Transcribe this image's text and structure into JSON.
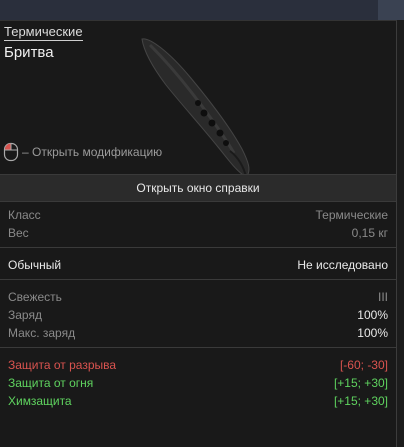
{
  "header": {
    "category": "Термические",
    "item_name": "Бритва"
  },
  "hint": {
    "icon": "mouse-icon",
    "text": "– Открыть модификацию"
  },
  "help_button": {
    "label": "Открыть окно справки"
  },
  "info": {
    "class_label": "Класс",
    "class_value": "Термические",
    "weight_label": "Вес",
    "weight_value": "0,15 кг"
  },
  "status": {
    "rarity": "Обычный",
    "research": "Не исследовано"
  },
  "condition": {
    "freshness_label": "Свежесть",
    "freshness_value": "III",
    "charge_label": "Заряд",
    "charge_value": "100%",
    "max_charge_label": "Макс. заряд",
    "max_charge_value": "100%"
  },
  "protections": [
    {
      "label": "Защита от разрыва",
      "value": "[-60; -30]",
      "color": "#d9534f"
    },
    {
      "label": "Защита от огня",
      "value": "[+15; +30]",
      "color": "#5fd35f"
    },
    {
      "label": "Химзащита",
      "value": "[+15; +30]",
      "color": "#5fd35f"
    }
  ]
}
